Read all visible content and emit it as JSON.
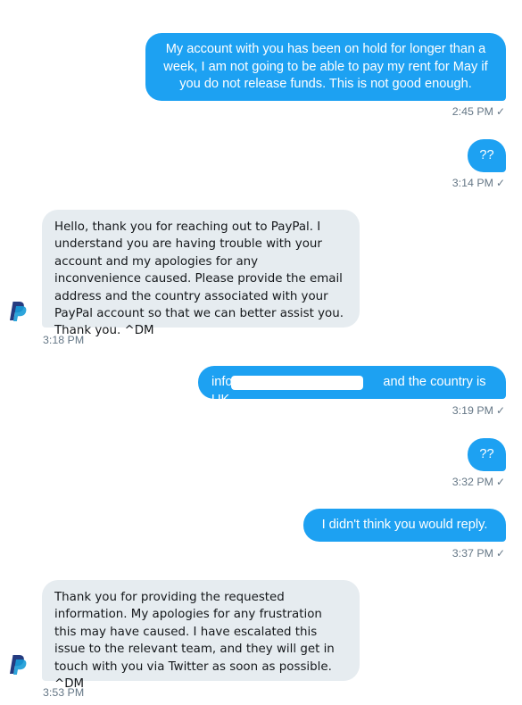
{
  "brand": {
    "name": "PayPal",
    "out_color": "#1da1f2",
    "in_color": "#e6ecf0",
    "logo_dark": "#253b80",
    "logo_light": "#179bd7"
  },
  "messages": [
    {
      "direction": "outgoing",
      "text": "My account with you has been on hold for longer than a week, I am not going to be able to pay my rent for May if you do not release funds. This is not good enough.",
      "time": "2:45 PM",
      "read": "✓"
    },
    {
      "direction": "outgoing",
      "text": "??",
      "time": "3:14 PM",
      "read": "✓"
    },
    {
      "direction": "incoming",
      "text": "Hello, thank you for reaching out to PayPal. I understand you are having trouble with your account and my apologies for any inconvenience caused. Please provide the email address and the country associated with your PayPal account so that we can better assist you. Thank you. ^DM",
      "time": "3:18 PM",
      "avatar_icon": "paypal-logo-icon"
    },
    {
      "direction": "outgoing",
      "text_prefix": "info@",
      "text_suffix": "and the country is UK.",
      "redacted": true,
      "time": "3:19 PM",
      "read": "✓"
    },
    {
      "direction": "outgoing",
      "text": "??",
      "time": "3:32 PM",
      "read": "✓"
    },
    {
      "direction": "outgoing",
      "text": "I didn't think you would reply.",
      "time": "3:37 PM",
      "read": "✓"
    },
    {
      "direction": "incoming",
      "text": "Thank you for providing the requested information. My apologies for any frustration this may have caused. I have escalated this issue to the relevant team, and they will get in touch with you via Twitter as soon as possible. ^DM",
      "time": "3:53 PM",
      "avatar_icon": "paypal-logo-icon"
    }
  ]
}
